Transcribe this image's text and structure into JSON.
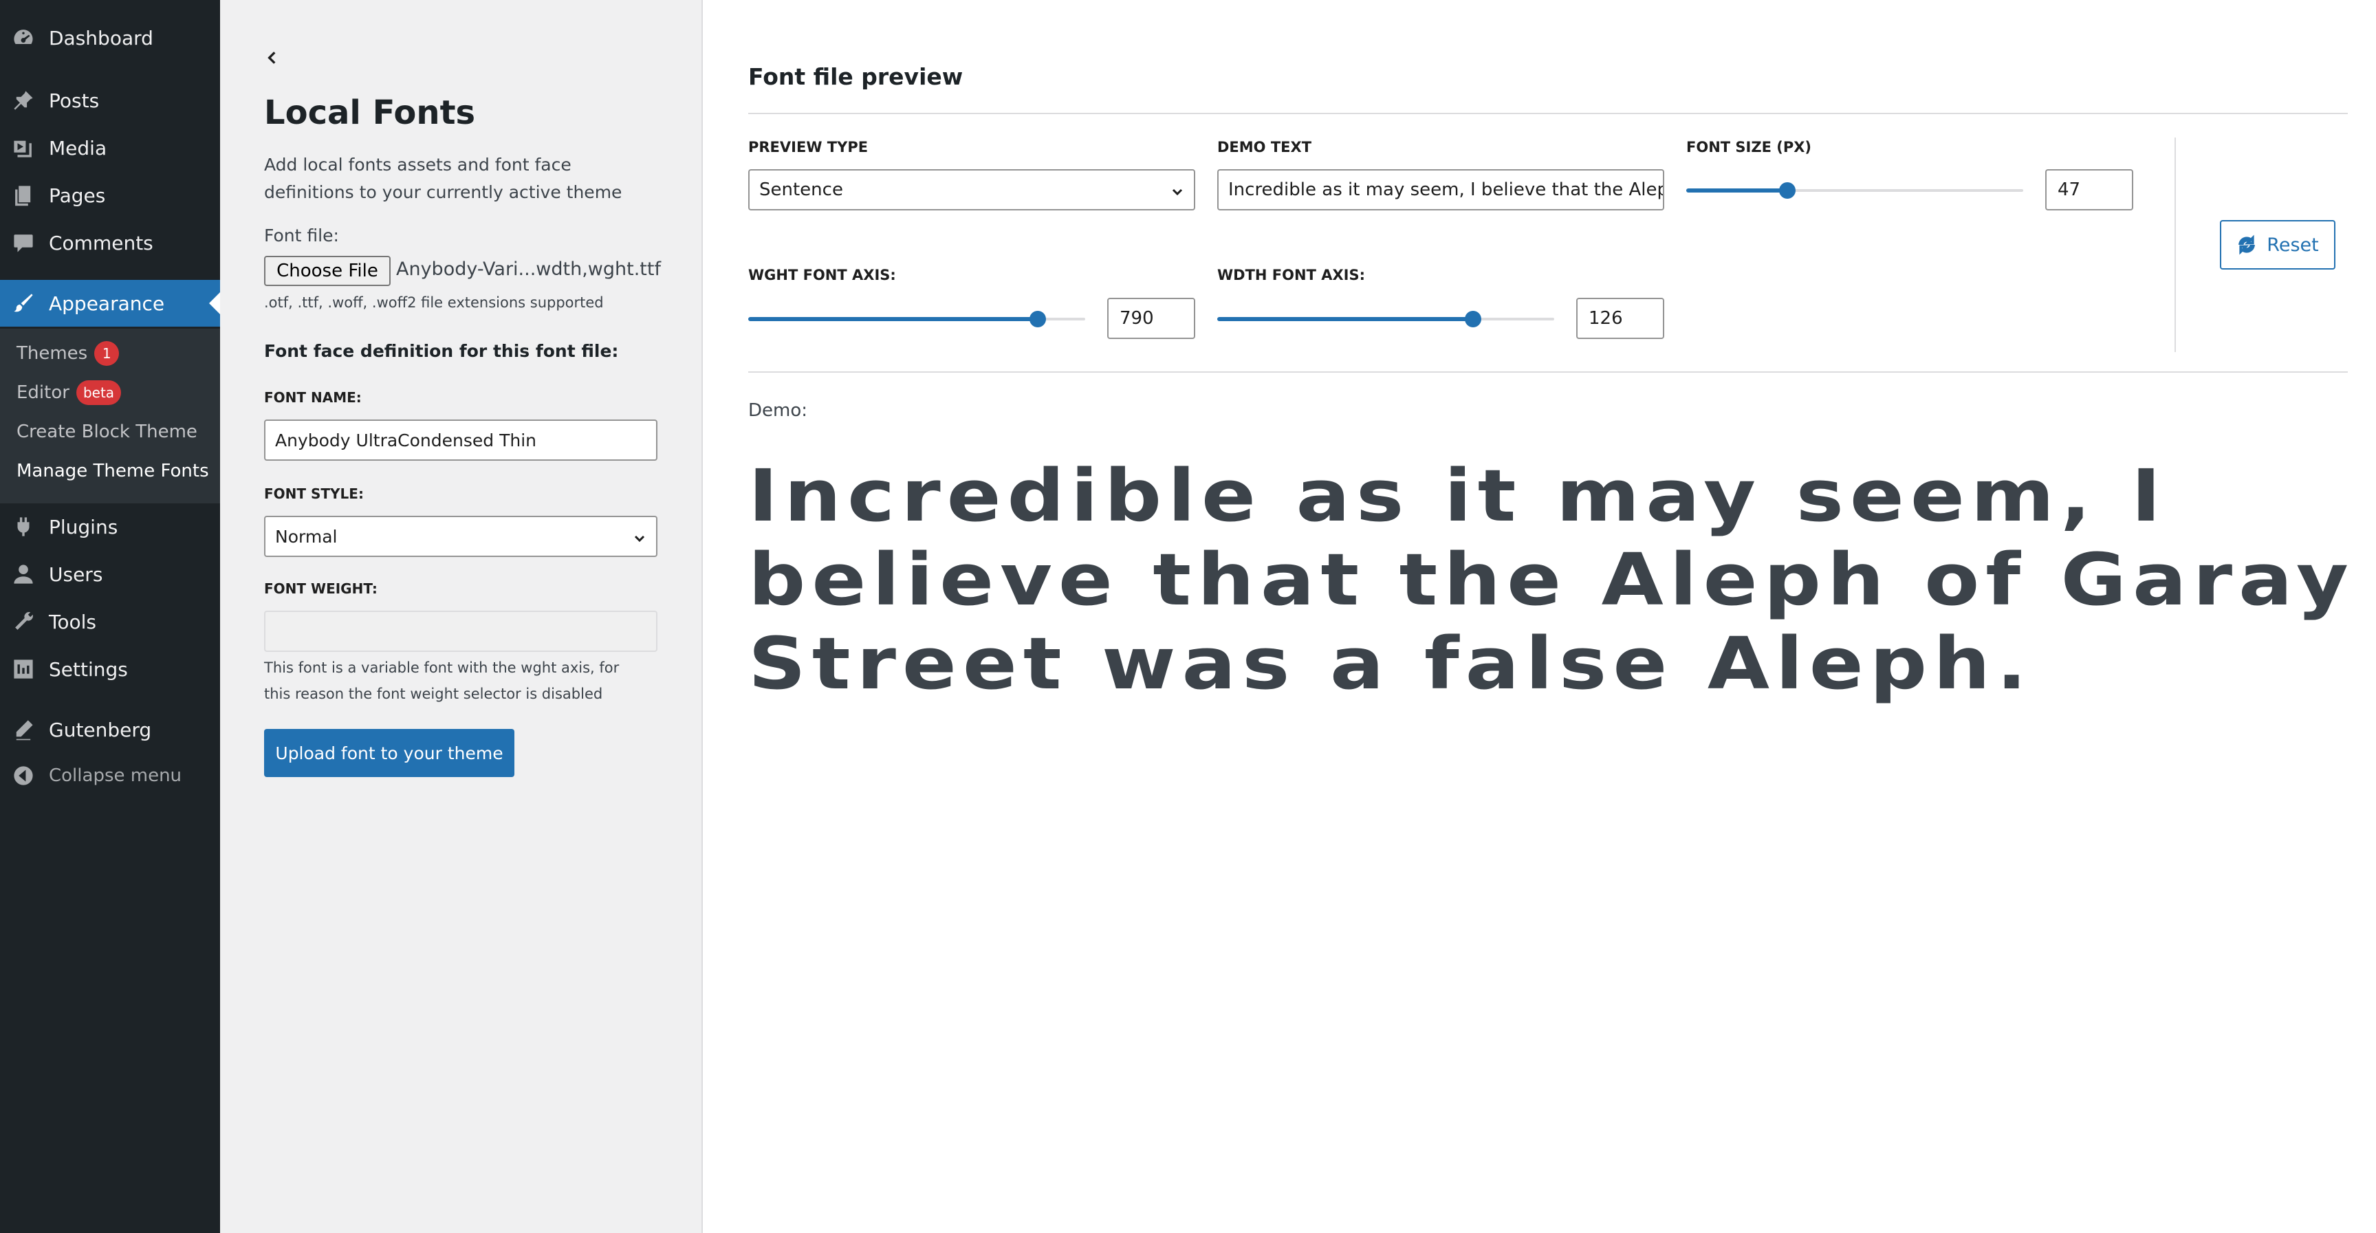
{
  "sidebar": {
    "items": [
      {
        "label": "Dashboard",
        "icon": "dashboard-icon"
      },
      {
        "label": "Posts",
        "icon": "pin-icon"
      },
      {
        "label": "Media",
        "icon": "media-icon"
      },
      {
        "label": "Pages",
        "icon": "pages-icon"
      },
      {
        "label": "Comments",
        "icon": "comment-icon"
      },
      {
        "label": "Appearance",
        "icon": "brush-icon"
      },
      {
        "label": "Plugins",
        "icon": "plugin-icon"
      },
      {
        "label": "Users",
        "icon": "user-icon"
      },
      {
        "label": "Tools",
        "icon": "wrench-icon"
      },
      {
        "label": "Settings",
        "icon": "settings-icon"
      },
      {
        "label": "Gutenberg",
        "icon": "pencil-icon"
      }
    ],
    "submenu": [
      {
        "label": "Themes",
        "badge": "1"
      },
      {
        "label": "Editor",
        "badge": "beta"
      },
      {
        "label": "Create Block Theme"
      },
      {
        "label": "Manage Theme Fonts"
      }
    ],
    "collapse_label": "Collapse menu"
  },
  "left": {
    "title": "Local Fonts",
    "description": "Add local fonts assets and font face definitions to your currently active theme",
    "font_file_label": "Font file:",
    "choose_file_label": "Choose File",
    "file_name": "Anybody-Vari...wdth,wght.ttf",
    "extensions_note": ".otf, .ttf, .woff, .woff2 file extensions supported",
    "section_heading": "Font face definition for this font file:",
    "font_name_label": "FONT NAME:",
    "font_name_value": "Anybody UltraCondensed Thin",
    "font_style_label": "FONT STYLE:",
    "font_style_value": "Normal",
    "font_weight_label": "FONT WEIGHT:",
    "font_weight_help": "This font is a variable font with the wght axis, for this reason the font weight selector is disabled",
    "upload_label": "Upload font to your theme"
  },
  "preview": {
    "title": "Font file preview",
    "preview_type_label": "PREVIEW TYPE",
    "preview_type_value": "Sentence",
    "demo_text_label": "DEMO TEXT",
    "demo_text_value": "Incredible as it may seem, I believe that the Aleph of",
    "font_size_label": "FONT SIZE (PX)",
    "font_size_value": "47",
    "font_size_fraction": 0.3,
    "wght_label": "WGHT FONT AXIS:",
    "wght_value": "790",
    "wght_fraction": 0.86,
    "wdth_label": "WDTH FONT AXIS:",
    "wdth_value": "126",
    "wdth_fraction": 0.76,
    "reset_label": "Reset",
    "demo_label": "Demo:",
    "demo_sentence_line1": "Incredible as it may seem, I",
    "demo_sentence_line2": "believe that the Aleph of Garay",
    "demo_sentence_line3": "Street was a false Aleph."
  },
  "colors": {
    "sidebar_bg": "#1d2327",
    "accent": "#2271b1",
    "badge": "#d63638"
  }
}
